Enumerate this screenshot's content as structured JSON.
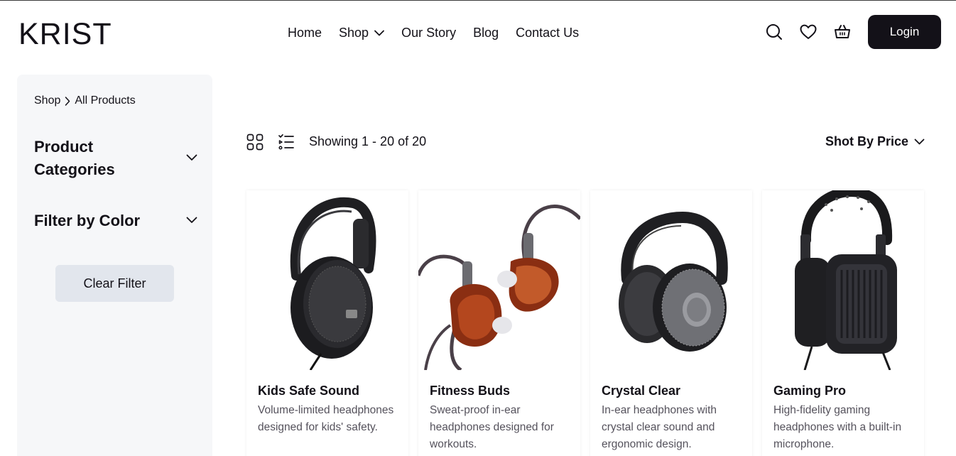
{
  "header": {
    "logo": "KRIST",
    "nav": [
      {
        "label": "Home"
      },
      {
        "label": "Shop"
      },
      {
        "label": "Our Story"
      },
      {
        "label": "Blog"
      },
      {
        "label": "Contact Us"
      }
    ],
    "icons": [
      "search-icon",
      "heart-icon",
      "basket-icon"
    ],
    "login_label": "Login"
  },
  "sidebar": {
    "breadcrumb": {
      "root": "Shop",
      "current": "All Products"
    },
    "filters": [
      {
        "title": "Product Categories"
      },
      {
        "title": "Filter by Color"
      }
    ],
    "clear_label": "Clear Filter"
  },
  "toolbar": {
    "showing_text": "Showing 1 - 20 of 20",
    "sort_label": "Shot By Price"
  },
  "products": [
    {
      "name": "Kids Safe Sound",
      "description": "Volume-limited headphones designed for kids' safety.",
      "image": "over-ear-headphones"
    },
    {
      "name": "Fitness Buds",
      "description": "Sweat-proof in-ear headphones designed for workouts.",
      "image": "in-ear-monitors"
    },
    {
      "name": "Crystal Clear",
      "description": "In-ear headphones with crystal clear sound and ergonomic design.",
      "image": "over-ear-headphones"
    },
    {
      "name": "Gaming Pro",
      "description": "High-fidelity gaming headphones with a built-in microphone.",
      "image": "planar-headphones"
    }
  ],
  "colors": {
    "primary": "#131118",
    "sidebar_bg": "#f6f7f9",
    "clear_button_bg": "#e2e6ed",
    "muted_text": "#55525c"
  }
}
